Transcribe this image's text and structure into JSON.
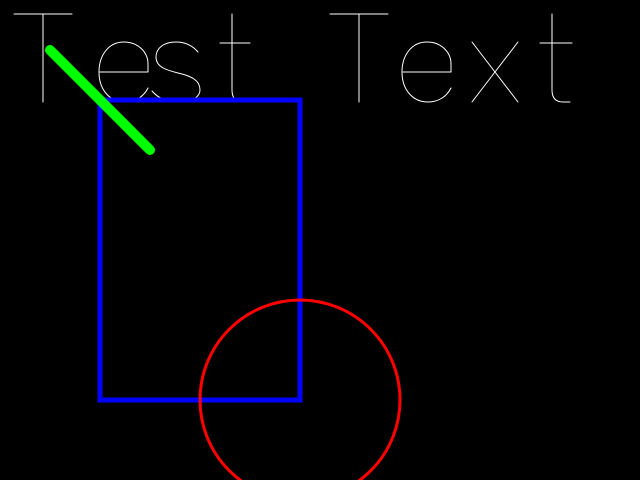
{
  "canvas": {
    "background": "#000000"
  },
  "text": {
    "content": "Test Text",
    "color": "#ffffff"
  },
  "shapes": {
    "line": {
      "color": "#00ff00"
    },
    "rectangle": {
      "color": "#0000ff"
    },
    "circle": {
      "color": "#ff0000"
    }
  }
}
